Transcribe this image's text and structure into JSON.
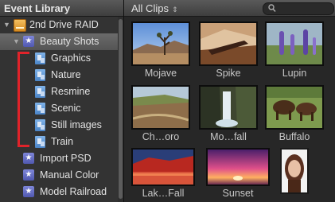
{
  "header": {
    "library_title": "Event Library",
    "filter_label": "All Clips",
    "filter_arrows": "⇕"
  },
  "sidebar": {
    "drive": "2nd Drive RAID",
    "event_selected": "Beauty Shots",
    "keyword_collections": [
      "Graphics",
      "Nature",
      "Resmine",
      "Scenic",
      "Still images",
      "Train"
    ],
    "events": [
      "Import PSD",
      "Manual Color",
      "Model Railroad"
    ]
  },
  "clips": [
    {
      "name": "Mojave"
    },
    {
      "name": "Spike"
    },
    {
      "name": "Lupin"
    },
    {
      "name": "Ch…oro"
    },
    {
      "name": "Mo…fall"
    },
    {
      "name": "Buffalo"
    },
    {
      "name": "Lak…Fall"
    },
    {
      "name": "Sunset"
    },
    {
      "name": ""
    }
  ],
  "colors": {
    "annotation_bracket": "#e0232a",
    "selection": "#5f5f5f",
    "event_icon": "#6a72c8",
    "collection_icon": "#5b93d6"
  }
}
